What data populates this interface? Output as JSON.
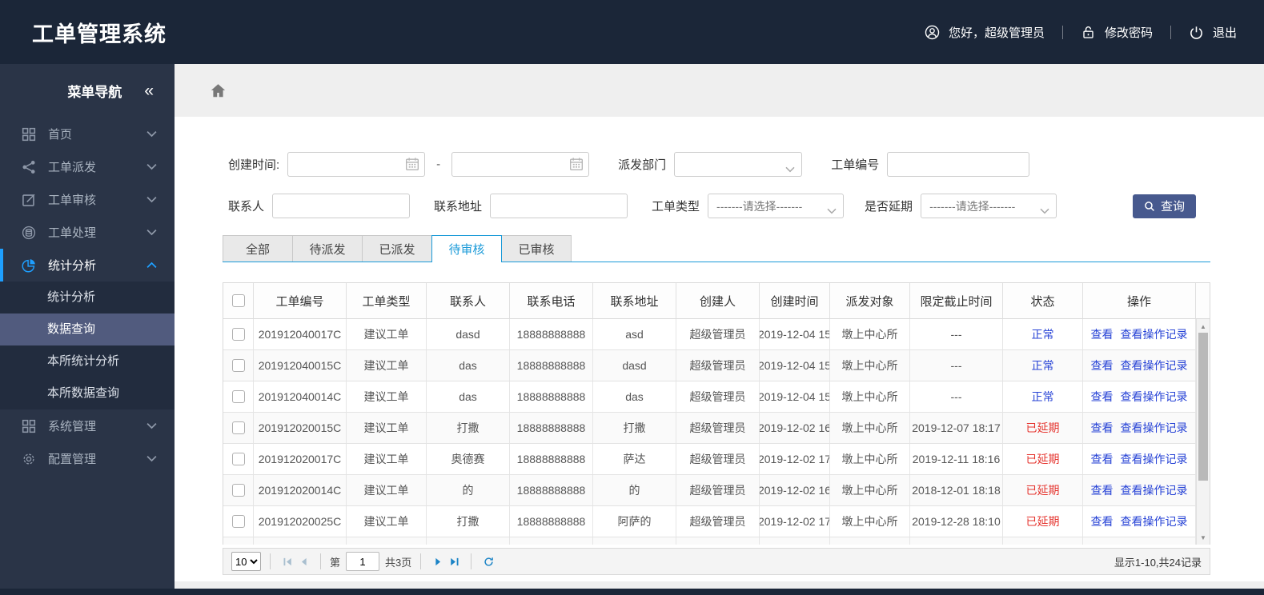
{
  "header": {
    "title": "工单管理系统",
    "greeting": "您好，超级管理员",
    "change_password": "修改密码",
    "logout": "退出"
  },
  "sidebar": {
    "title": "菜单导航",
    "collapse_glyph": "«",
    "items": [
      {
        "id": "home",
        "label": "首页",
        "icon": "grid-icon",
        "expanded": false,
        "active": false
      },
      {
        "id": "dispatch",
        "label": "工单派发",
        "icon": "share-icon",
        "expanded": false,
        "active": false
      },
      {
        "id": "review",
        "label": "工单审核",
        "icon": "edit-icon",
        "expanded": false,
        "active": false
      },
      {
        "id": "process",
        "label": "工单处理",
        "icon": "process-icon",
        "expanded": false,
        "active": false
      },
      {
        "id": "stats",
        "label": "统计分析",
        "icon": "pie-icon",
        "expanded": true,
        "active": true,
        "children": [
          {
            "label": "统计分析",
            "selected": false
          },
          {
            "label": "数据查询",
            "selected": true
          },
          {
            "label": "本所统计分析",
            "selected": false
          },
          {
            "label": "本所数据查询",
            "selected": false
          }
        ]
      },
      {
        "id": "system",
        "label": "系统管理",
        "icon": "apps-icon",
        "expanded": false,
        "active": false
      },
      {
        "id": "config",
        "label": "配置管理",
        "icon": "gear-icon",
        "expanded": false,
        "active": false
      }
    ]
  },
  "filters": {
    "create_time_label": "创建时间:",
    "create_time_from": "",
    "create_time_to": "",
    "range_separator": "-",
    "dispatch_dept_label": "派发部门",
    "dispatch_dept_value": "",
    "order_no_label": "工单编号",
    "order_no_value": "",
    "contact_label": "联系人",
    "contact_value": "",
    "address_label": "联系地址",
    "address_value": "",
    "order_type_label": "工单类型",
    "order_type_value": "-------请选择-------",
    "delay_label": "是否延期",
    "delay_value": "-------请选择-------",
    "search_button": "查询"
  },
  "tabs": [
    {
      "label": "全部",
      "active": false
    },
    {
      "label": "待派发",
      "active": false
    },
    {
      "label": "已派发",
      "active": false
    },
    {
      "label": "待审核",
      "active": true
    },
    {
      "label": "已审核",
      "active": false
    }
  ],
  "table": {
    "columns": [
      "工单编号",
      "工单类型",
      "联系人",
      "联系电话",
      "联系地址",
      "创建人",
      "创建时间",
      "派发对象",
      "限定截止时间",
      "状态",
      "操作"
    ],
    "action_labels": [
      "查看",
      "查看操作记录"
    ],
    "rows": [
      {
        "order_no": "201912040017C",
        "type": "建议工单",
        "contact": "dasd",
        "phone": "18888888888",
        "address": "asd",
        "creator": "超级管理员",
        "created": "2019-12-04 15",
        "target": "墩上中心所",
        "deadline": "---",
        "status": "正常",
        "status_type": "normal"
      },
      {
        "order_no": "201912040015C",
        "type": "建议工单",
        "contact": "das",
        "phone": "18888888888",
        "address": "dasd",
        "creator": "超级管理员",
        "created": "2019-12-04 15",
        "target": "墩上中心所",
        "deadline": "---",
        "status": "正常",
        "status_type": "normal"
      },
      {
        "order_no": "201912040014C",
        "type": "建议工单",
        "contact": "das",
        "phone": "18888888888",
        "address": "das",
        "creator": "超级管理员",
        "created": "2019-12-04 15",
        "target": "墩上中心所",
        "deadline": "---",
        "status": "正常",
        "status_type": "normal"
      },
      {
        "order_no": "201912020015C",
        "type": "建议工单",
        "contact": "打撒",
        "phone": "18888888888",
        "address": "打撒",
        "creator": "超级管理员",
        "created": "2019-12-02 16",
        "target": "墩上中心所",
        "deadline": "2019-12-07 18:17",
        "status": "已延期",
        "status_type": "delayed"
      },
      {
        "order_no": "201912020017C",
        "type": "建议工单",
        "contact": "奥德赛",
        "phone": "18888888888",
        "address": "萨达",
        "creator": "超级管理员",
        "created": "2019-12-02 17",
        "target": "墩上中心所",
        "deadline": "2019-12-11 18:16",
        "status": "已延期",
        "status_type": "delayed"
      },
      {
        "order_no": "201912020014C",
        "type": "建议工单",
        "contact": "的",
        "phone": "18888888888",
        "address": "的",
        "creator": "超级管理员",
        "created": "2019-12-02 16",
        "target": "墩上中心所",
        "deadline": "2018-12-01 18:18",
        "status": "已延期",
        "status_type": "delayed"
      },
      {
        "order_no": "201912020025C",
        "type": "建议工单",
        "contact": "打撒",
        "phone": "18888888888",
        "address": "阿萨的",
        "creator": "超级管理员",
        "created": "2019-12-02 17",
        "target": "墩上中心所",
        "deadline": "2019-12-28 18:10",
        "status": "已延期",
        "status_type": "delayed"
      }
    ],
    "has_partial_next_row": true
  },
  "pagination": {
    "page_size": "10",
    "page_prefix": "第",
    "current_page": "1",
    "total_pages_label": "共3页",
    "summary": "显示1-10,共24记录"
  },
  "colors": {
    "header_bg": "#1b2638",
    "sidebar_bg": "#2a3447",
    "submenu_bg": "#222c3e",
    "selected_submenu_bg": "#515b7e",
    "accent_blue": "#1e9fff",
    "tab_active_blue": "#1a9ad8",
    "link_blue": "#2743d6",
    "status_normal": "#2743d6",
    "status_delayed": "#e5342e",
    "search_button_bg": "#47598e",
    "page_icon_blue": "#1c84c6",
    "page_icon_disabled": "#a9bfcf"
  }
}
